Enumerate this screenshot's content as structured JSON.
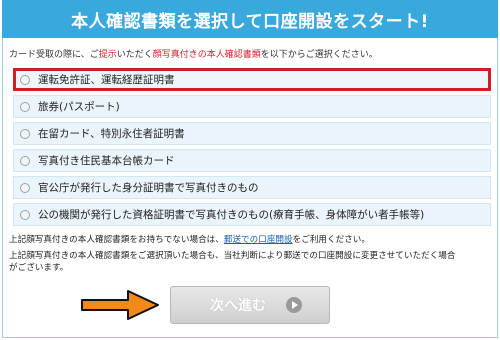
{
  "banner": {
    "title": "本人確認書類を選択して口座開設をスタート!"
  },
  "instruction": {
    "part1": "カード受取の際に、ご",
    "part2": "提示",
    "part3": "いただく",
    "part4": "顔写真付きの本人確認書類",
    "part5": "を以下からご選択ください。"
  },
  "options": [
    {
      "label": "運転免許証、運転経歴証明書",
      "highlighted": true
    },
    {
      "label": "旅券(パスポート)",
      "highlighted": false
    },
    {
      "label": "在留カード、特別永住者証明書",
      "highlighted": false
    },
    {
      "label": "写真付き住民基本台帳カード",
      "highlighted": false
    },
    {
      "label": "官公庁が発行した身分証明書で写真付きのもの",
      "highlighted": false
    },
    {
      "label": "公の機関が発行した資格証明書で写真付きのもの(療育手帳、身体障がい者手帳等)",
      "highlighted": false
    }
  ],
  "notes": {
    "line1_prefix": "上記顔写真付きの本人確認書類をお持ちでない場合は、",
    "line1_link": "郵送での口座開設",
    "line1_suffix": "をご利用ください。",
    "line2_prefix": "上記顔写真付きの本人確認書類をご選択頂いた場合も、当社判断により郵送での口座開設に変更させていただく場合",
    "line2_cont": "がございます。"
  },
  "next_button": {
    "label": "次へ進む",
    "icon": "play-circle-icon"
  },
  "arrow": {
    "icon": "arrow-right-icon",
    "color": "#f28a18"
  }
}
